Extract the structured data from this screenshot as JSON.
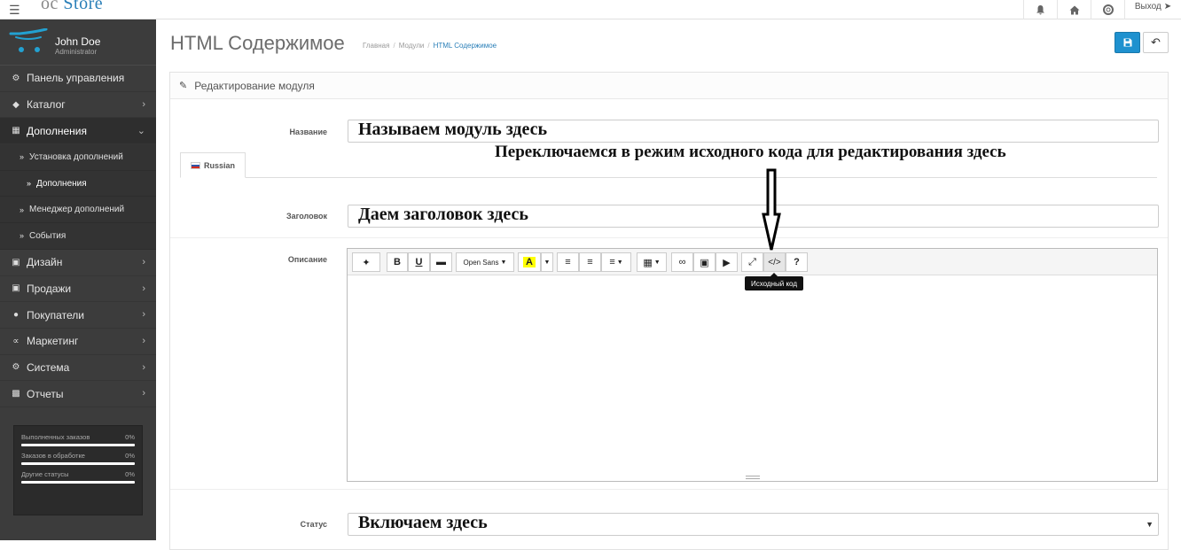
{
  "topbar": {
    "logo_prefix": "oc",
    "logo_main": "Store",
    "logout_label": "Выход"
  },
  "icons": {
    "menu": "hamburger-icon",
    "bell": "bell-icon",
    "home": "home-icon",
    "help": "lifebuoy-icon",
    "logout": "logout-icon"
  },
  "user": {
    "name": "John Doe",
    "role": "Administrator"
  },
  "nav": {
    "dashboard": "Панель управления",
    "catalog": "Каталог",
    "extensions": "Дополнения",
    "sub_install": "Установка дополнений",
    "sub_extensions": "Дополнения",
    "sub_manager": "Менеджер дополнений",
    "sub_events": "События",
    "design": "Дизайн",
    "sales": "Продажи",
    "customers": "Покупатели",
    "marketing": "Маркетинг",
    "system": "Система",
    "reports": "Отчеты"
  },
  "stats": [
    {
      "label": "Выполненных заказов",
      "value": "0%",
      "progress": 0
    },
    {
      "label": "Заказов в обработке",
      "value": "0%",
      "progress": 0
    },
    {
      "label": "Другие статусы",
      "value": "0%",
      "progress": 0
    }
  ],
  "page": {
    "title": "HTML Содержимое",
    "breadcrumb": [
      "Главная",
      "Модули",
      "HTML Содержимое"
    ],
    "panel_title": "Редактирование модуля"
  },
  "form": {
    "name_label": "Название",
    "name_value": "",
    "tab_russian": "Russian",
    "heading_label": "Заголовок",
    "heading_value": "",
    "description_label": "Описание",
    "status_label": "Статус"
  },
  "editor": {
    "font_name": "Open Sans",
    "bold": "B",
    "underline": "U",
    "highlight": "A",
    "help": "?",
    "codeview": "</>",
    "tooltip": "Исходный код"
  },
  "annotations": {
    "name_hint": "Называем модуль здесь",
    "codeview_hint": "Переключаемся в режим исходного кода для редактирования здесь",
    "heading_hint": "Даем заголовок здесь",
    "status_hint": "Включаем здесь"
  },
  "colors": {
    "accent": "#1e91cf",
    "sidebar_bg": "#3c3c3c",
    "link": "#2a7fb8"
  }
}
